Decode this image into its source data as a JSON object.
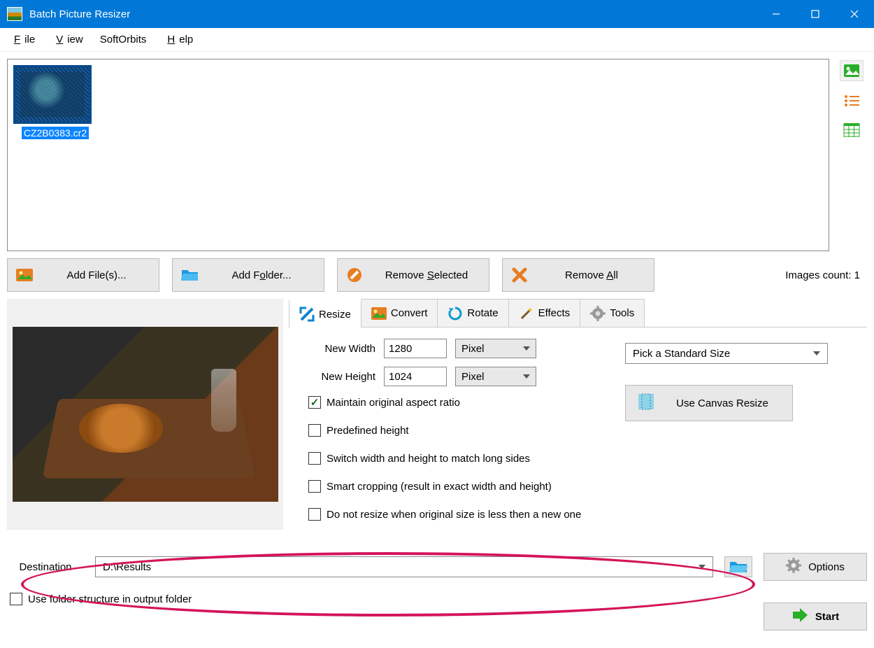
{
  "title": "Batch Picture Resizer",
  "menu": {
    "file": "File",
    "view": "View",
    "softorbits": "SoftOrbits",
    "help": "Help"
  },
  "thumbnail": {
    "filename": "CZ2B0383.cr2"
  },
  "toolbar": {
    "add_files": "Add File(s)...",
    "add_folder": "Add Folder...",
    "remove_selected": "Remove Selected",
    "remove_all": "Remove All"
  },
  "count_label": "Images count: 1",
  "tabs": {
    "resize": "Resize",
    "convert": "Convert",
    "rotate": "Rotate",
    "effects": "Effects",
    "tools": "Tools"
  },
  "resize": {
    "new_width_label": "New Width",
    "new_width_value": "1280",
    "new_height_label": "New Height",
    "new_height_value": "1024",
    "unit": "Pixel",
    "maintain_ratio": "Maintain original aspect ratio",
    "predefined_height": "Predefined height",
    "switch_sides": "Switch width and height to match long sides",
    "smart_cropping": "Smart cropping (result in exact width and height)",
    "no_resize_smaller": "Do not resize when original size is less then a new one",
    "standard_size": "Pick a Standard Size",
    "canvas_resize": "Use Canvas Resize"
  },
  "destination": {
    "label": "Destination",
    "value": "D:\\Results",
    "use_folder_structure": "Use folder structure in output folder"
  },
  "buttons": {
    "options": "Options",
    "start": "Start"
  }
}
